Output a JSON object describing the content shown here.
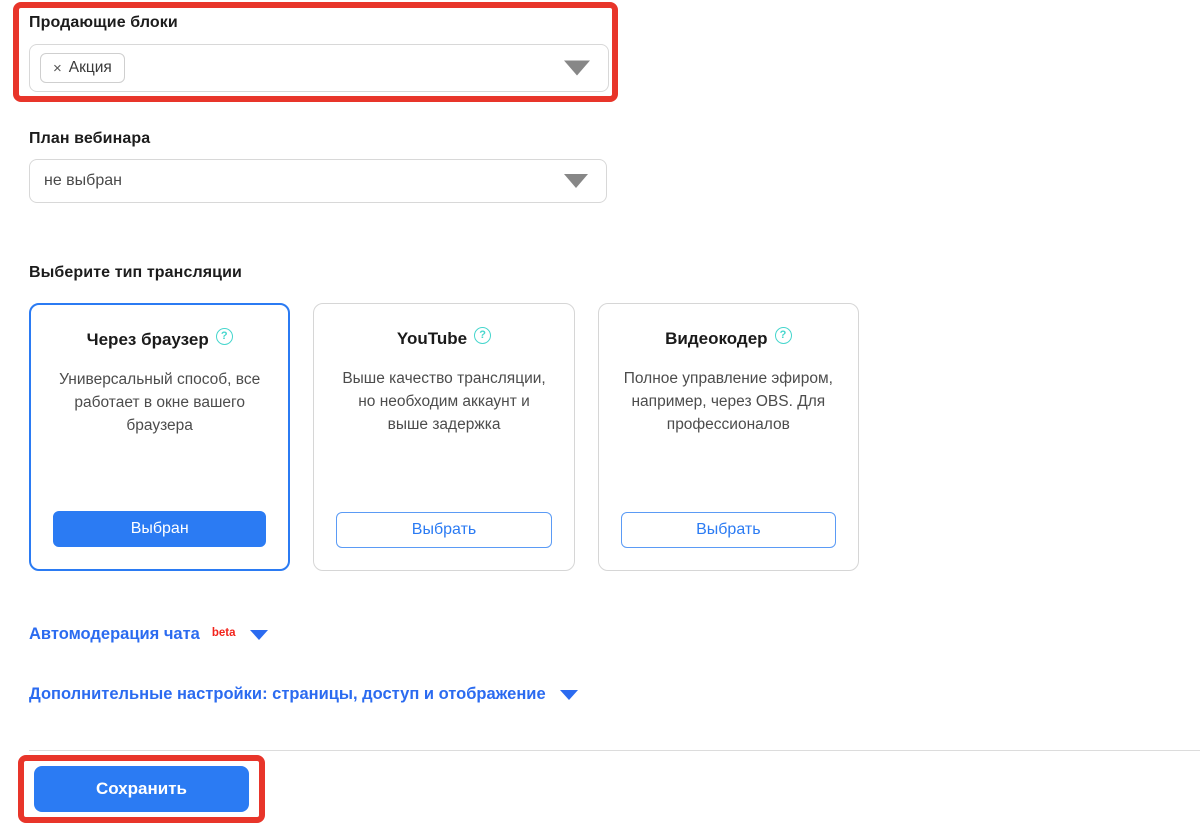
{
  "selling_blocks": {
    "label": "Продающие блоки",
    "tags": [
      {
        "remove_glyph": "×",
        "text": "Акция"
      }
    ],
    "dropdown_icon": "triangle-down-icon"
  },
  "webinar_plan": {
    "label": "План вебинара",
    "value": "не выбран",
    "dropdown_icon": "triangle-down-icon"
  },
  "broadcast_type": {
    "label": "Выберите тип трансляции",
    "help_glyph": "?",
    "cards": [
      {
        "title": "Через браузер",
        "description": "Универсальный способ, все работает в окне вашего браузера",
        "button_label": "Выбран",
        "selected": true
      },
      {
        "title": "YouTube",
        "description": "Выше качество трансляции, но необходим аккаунт и выше задержка",
        "button_label": "Выбрать",
        "selected": false
      },
      {
        "title": "Видеокодер",
        "description": "Полное управление эфиром, например, через OBS. Для профессионалов",
        "button_label": "Выбрать",
        "selected": false
      }
    ]
  },
  "disclosures": [
    {
      "label": "Автомодерация чата",
      "badge": "beta",
      "caret_icon": "caret-down-icon"
    },
    {
      "label": "Дополнительные настройки: страницы, доступ и отображение",
      "badge": "",
      "caret_icon": "caret-down-icon"
    }
  ],
  "footer": {
    "save_label": "Сохранить"
  },
  "colors": {
    "accent_blue": "#2b7bf3",
    "link_blue": "#2b6bf0",
    "highlight_red": "#e8352a",
    "beta_red": "#f2231b",
    "help_teal": "#46d6cd"
  }
}
